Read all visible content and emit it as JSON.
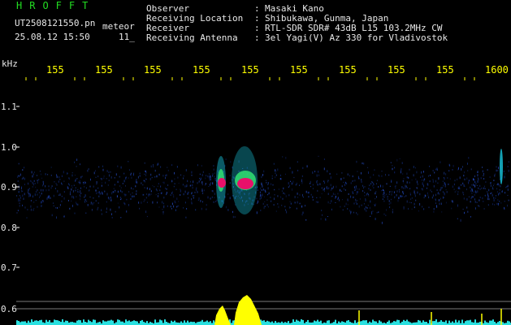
{
  "header": {
    "title": "HROFFT",
    "filename": "UT2508121550.pn",
    "tag": "meteor",
    "datetime": "25.08.12 15:50",
    "count": "11_"
  },
  "info": [
    {
      "label": "Observer",
      "value": "Masaki Kano"
    },
    {
      "label": "Receiving Location",
      "value": "Shibukawa, Gunma, Japan"
    },
    {
      "label": "Receiver",
      "value": "RTL-SDR SDR# 43dB L15 103.2MHz CW"
    },
    {
      "label": "Receiving Antenna",
      "value": "3el Yagi(V) Az 330 for Vladivostok"
    }
  ],
  "axis": {
    "unit": "kHz",
    "top_ticks": [
      "155",
      "155",
      "155",
      "155",
      "155",
      "155",
      "155",
      "155",
      "155",
      "1600"
    ],
    "y_labels": [
      "1.1",
      "1.0",
      "0.9",
      "0.8",
      "0.7",
      "0.6"
    ]
  },
  "colors": {
    "header_green": "#22dd22",
    "text_white": "#e8e8e8",
    "tick_yellow": "#ffff00",
    "noise_blue": "#1b3a9a",
    "echo_cyan": "#18c8e0",
    "echo_green": "#30d870",
    "echo_core": "#e8106a",
    "meter_yellow": "#ffff00",
    "meter_cyan": "#29e0e0"
  }
}
